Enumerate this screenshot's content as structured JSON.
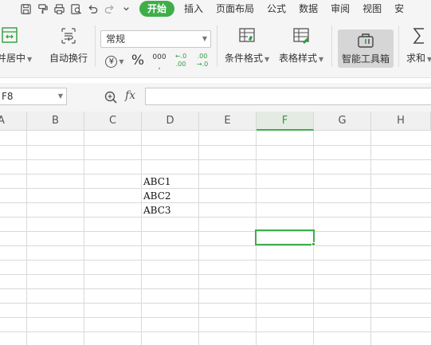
{
  "menubar": {
    "quick_icons": [
      "save-icon",
      "format-painter-icon",
      "print-icon",
      "print-preview-icon",
      "undo-icon",
      "redo-icon",
      "more-icon"
    ],
    "tabs": [
      "开始",
      "插入",
      "页面布局",
      "公式",
      "数据",
      "审阅",
      "视图",
      "安"
    ],
    "active_tab": "开始",
    "accent_color": "#3fae49"
  },
  "ribbon": {
    "merge_label": "合并居中",
    "wrap_label": "自动换行",
    "number_format": "常规",
    "currency_symbol": "¥",
    "percent_symbol": "%",
    "thousands_symbol": "000",
    "decrease_decimal": "←.0 .00",
    "increase_decimal": ".00 →.0",
    "cond_format_label": "条件格式",
    "table_style_label": "表格样式",
    "smart_toolbox_label": "智能工具箱",
    "sum_label": "求和"
  },
  "formula_bar": {
    "name_box": "F8",
    "fx_label": "fx",
    "formula": ""
  },
  "sheet": {
    "columns": [
      "A",
      "B",
      "C",
      "D",
      "E",
      "F",
      "G",
      "H"
    ],
    "active_column": "F",
    "selected_cell": "F8",
    "cells": {
      "D4": "ABC1",
      "D5": "ABC2",
      "D6": "ABC3"
    }
  }
}
